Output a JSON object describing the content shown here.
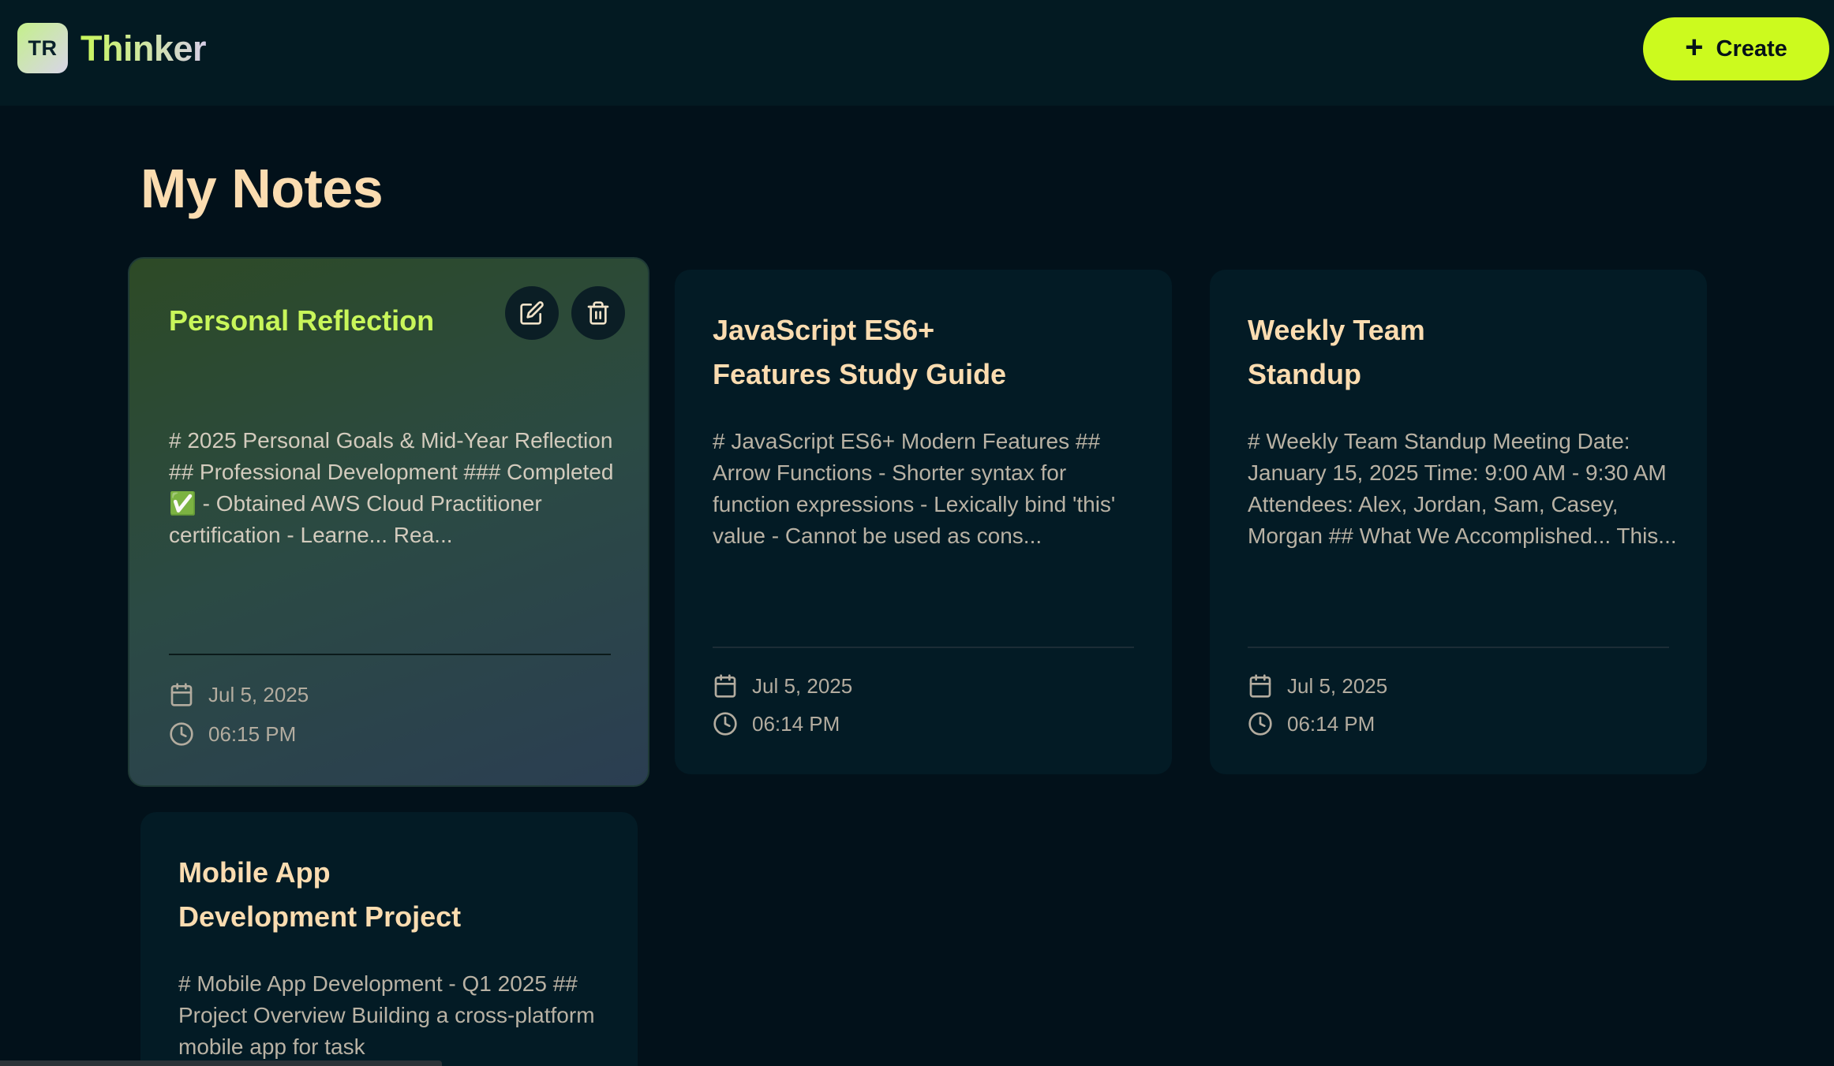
{
  "header": {
    "logo_initials": "TR",
    "app_name": "Thinker",
    "create_label": "Create",
    "create_icon": "plus-icon"
  },
  "page_title": "My Notes",
  "colors": {
    "background": "#02111a",
    "header": "#031a22",
    "accent": "#ccfa1e",
    "title": "#fbdcb0",
    "active_title": "#c8f65a"
  },
  "notes": [
    {
      "title_lines": [
        "Personal Reflection"
      ],
      "excerpt": "# 2025 Personal Goals & Mid-Year Reflection ## Professional Development ### Completed ✅ - Obtained AWS Cloud Practitioner certification - Learne... Rea...",
      "date": "Jul 5, 2025",
      "time": "06:15 PM",
      "active": true,
      "actions": [
        "edit-icon",
        "trash-icon"
      ]
    },
    {
      "title_lines": [
        "JavaScript ES6+",
        "Features Study Guide"
      ],
      "excerpt": "# JavaScript ES6+ Modern Features ## Arrow Functions - Shorter syntax for function expressions - Lexically bind 'this' value - Cannot be used as cons...",
      "date": "Jul 5, 2025",
      "time": "06:14 PM"
    },
    {
      "title_lines": [
        "Weekly Team",
        "Standup"
      ],
      "excerpt": "# Weekly Team Standup Meeting Date: January 15, 2025 Time: 9:00 AM - 9:30 AM Attendees: Alex, Jordan, Sam, Casey, Morgan ## What We Accomplished... This...",
      "date": "Jul 5, 2025",
      "time": "06:14 PM"
    },
    {
      "title_lines": [
        "Mobile App",
        "Development Project"
      ],
      "excerpt": "# Mobile App Development - Q1 2025 ## Project Overview Building a cross-platform mobile app for task",
      "date": "",
      "time": ""
    }
  ]
}
